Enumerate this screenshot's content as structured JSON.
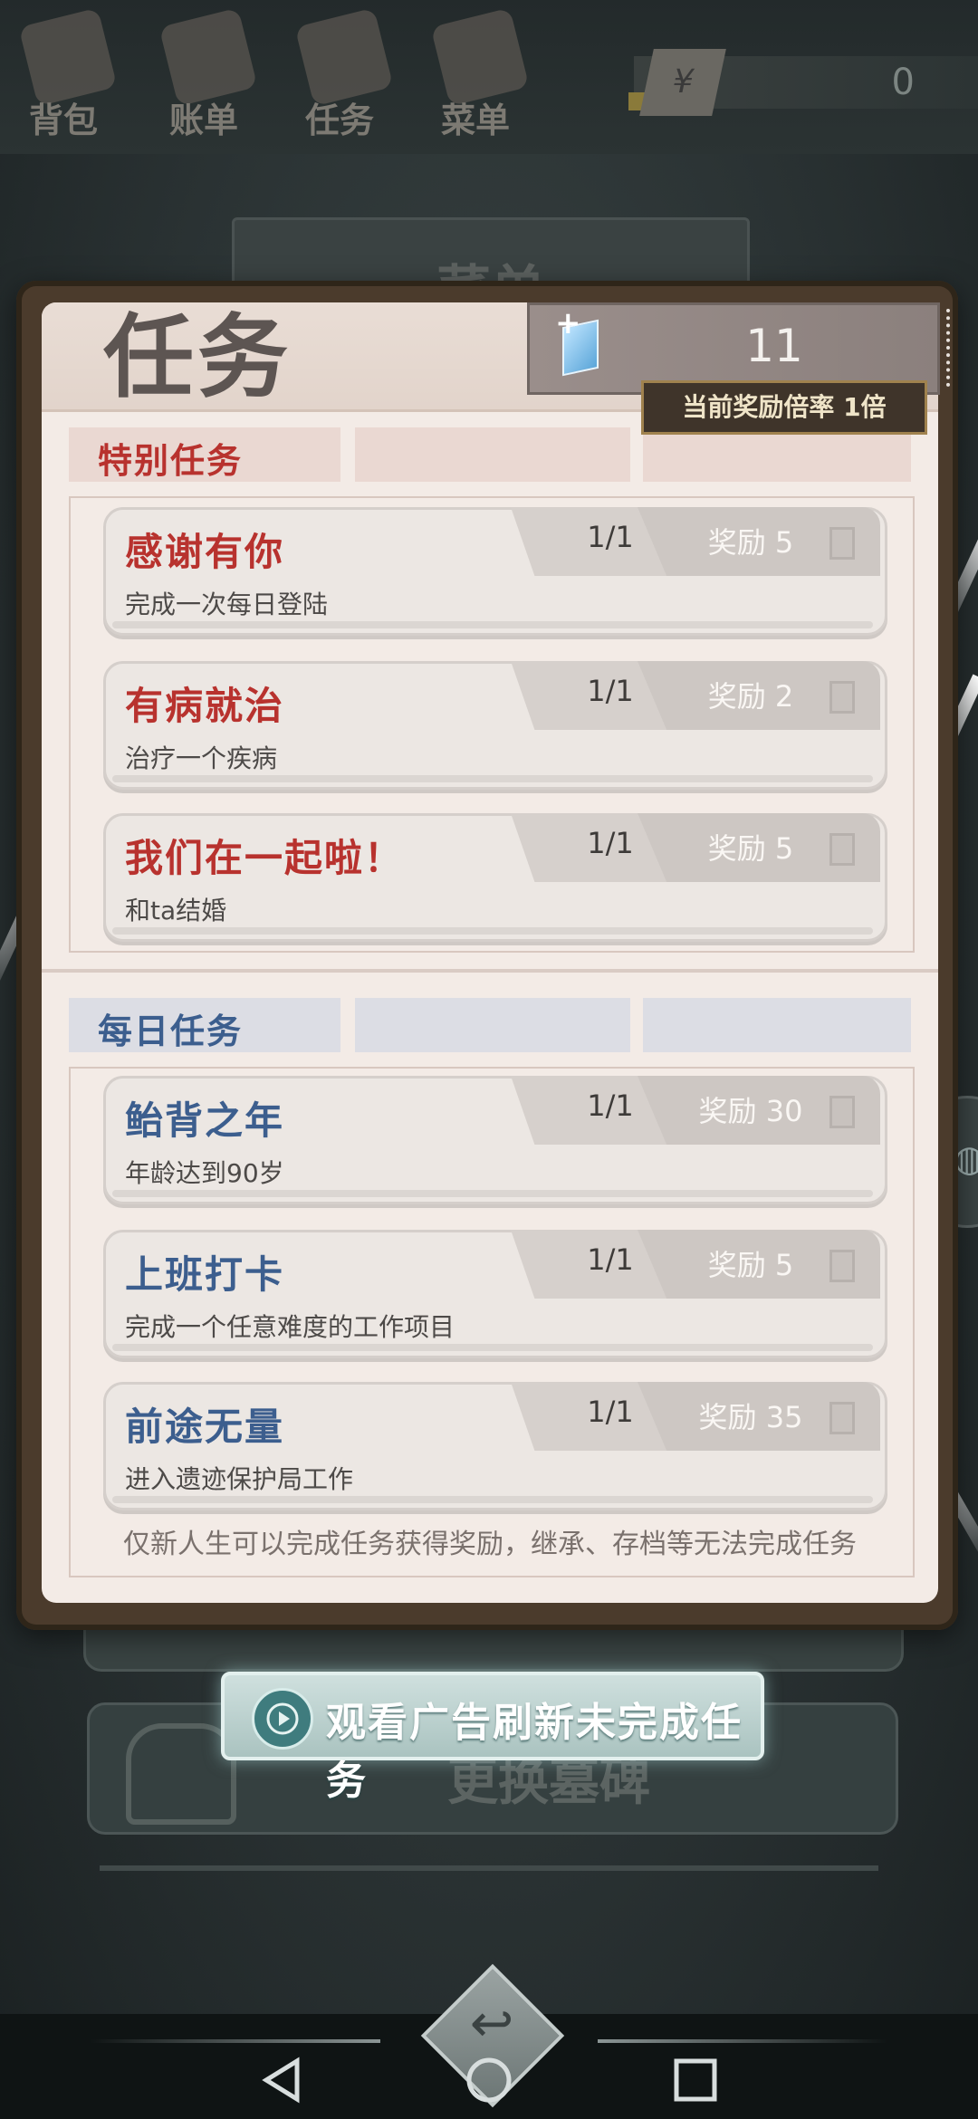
{
  "topbar": {
    "items": [
      {
        "label": "背包",
        "icon": "backpack-icon"
      },
      {
        "label": "账单",
        "icon": "bill-icon"
      },
      {
        "label": "任务",
        "icon": "task-icon"
      },
      {
        "label": "菜单",
        "icon": "menu-icon"
      }
    ],
    "currency_symbol": "¥",
    "money": "0"
  },
  "background": {
    "menu_title": "菜单",
    "card_title": "更换墓碑"
  },
  "panel": {
    "title": "任务",
    "reward_count": "11",
    "multiplier": "当前奖励倍率 1倍",
    "special": {
      "label": "特别任务",
      "color": "#b8322e",
      "quests": [
        {
          "title": "感谢有你",
          "desc": "完成一次每日登陆",
          "progress": "1/1",
          "reward": "奖励 5"
        },
        {
          "title": "有病就治",
          "desc": "治疗一个疾病",
          "progress": "1/1",
          "reward": "奖励 2"
        },
        {
          "title": "我们在一起啦！",
          "desc": "和ta结婚",
          "progress": "1/1",
          "reward": "奖励 5"
        }
      ]
    },
    "daily": {
      "label": "每日任务",
      "color": "#3c5e8e",
      "quests": [
        {
          "title": "鲐背之年",
          "desc": "年龄达到90岁",
          "progress": "1/1",
          "reward": "奖励 30"
        },
        {
          "title": "上班打卡",
          "desc": "完成一个任意难度的工作项目",
          "progress": "1/1",
          "reward": "奖励 5"
        },
        {
          "title": "前途无量",
          "desc": "进入遗迹保护局工作",
          "progress": "1/1",
          "reward": "奖励 35"
        }
      ]
    },
    "note": "仅新人生可以完成任务获得奖励，继承、存档等无法完成任务"
  },
  "ad_button": {
    "label": "观看广告刷新未完成任务",
    "icon": "play-icon"
  },
  "nav": {
    "back_icon": "back-icon",
    "home_icon": "home-icon",
    "recents_icon": "recents-icon",
    "return_icon": "return-icon"
  }
}
